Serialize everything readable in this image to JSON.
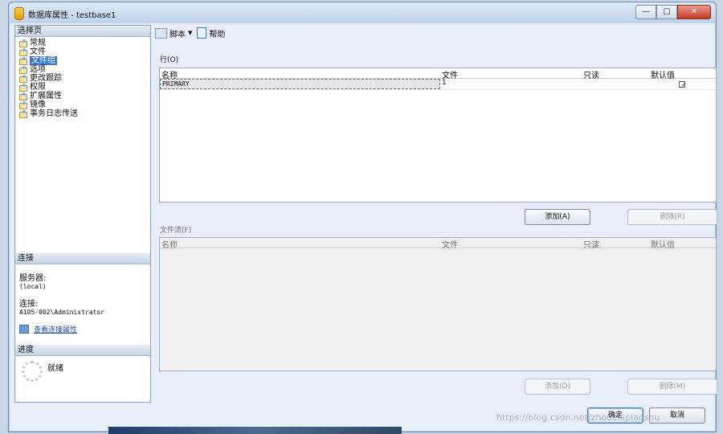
{
  "window": {
    "title": "数据库属性 - testbase1",
    "buttons": [
      "—",
      "▢",
      "✕"
    ]
  },
  "left": {
    "select_page_header": "选择页",
    "pages": [
      "常规",
      "文件",
      "文件组",
      "选项",
      "更改跟踪",
      "权限",
      "扩展属性",
      "镜像",
      "事务日志传送"
    ],
    "selected_page_index": 2,
    "connection_header": "连接",
    "server_label": "服务器:",
    "server_value": "(local)",
    "connection_label": "连接:",
    "connection_value": "A105-002\\Administrator",
    "view_link": "查看连接属性",
    "progress_header": "进度",
    "progress_status": "就绪"
  },
  "toolbar": {
    "script_label": "脚本",
    "help_label": "帮助"
  },
  "rows_group": {
    "label": "行(O)",
    "columns": [
      "名称",
      "文件",
      "只读",
      "默认值"
    ],
    "rows": [
      {
        "name": "PRIMARY",
        "files": "1",
        "readonly": "",
        "default": true
      }
    ],
    "add_button": "添加(A)",
    "delete_button": "删除(R)"
  },
  "filestream_group": {
    "label": "文件流(F)",
    "columns": [
      "名称",
      "文件",
      "只读",
      "默认值"
    ],
    "add_button": "添加(D)",
    "delete_button": "删除(M)"
  },
  "footer": {
    "ok_button": "确定",
    "cancel_button": "取消"
  },
  "watermark": "https://blog.csdn.net/zhouchiplaoshu"
}
